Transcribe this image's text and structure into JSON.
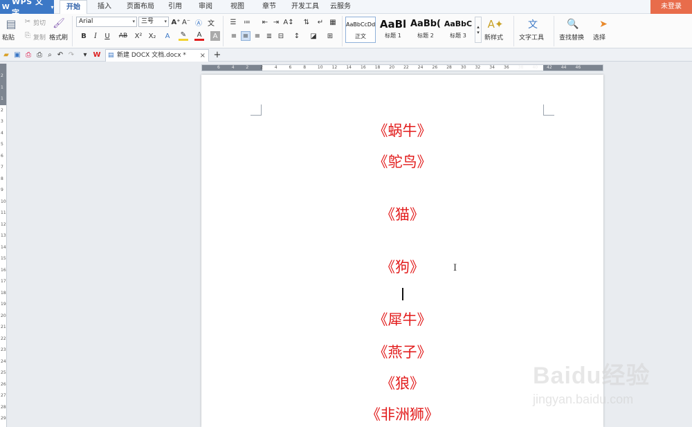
{
  "app": {
    "name": "WPS 文字",
    "login": "未登录"
  },
  "menu_tabs": [
    "开始",
    "插入",
    "页面布局",
    "引用",
    "审阅",
    "视图",
    "章节",
    "开发工具",
    "云服务"
  ],
  "active_tab": "开始",
  "ribbon": {
    "paste": "粘贴",
    "cut": "剪切",
    "copy": "复制",
    "format_painter": "格式刷",
    "font_name": "Arial",
    "font_size": "三号",
    "styles": [
      {
        "preview": "AaBbCcDd",
        "name": "正文"
      },
      {
        "preview": "AaBl",
        "name": "标题 1"
      },
      {
        "preview": "AaBb(",
        "name": "标题 2"
      },
      {
        "preview": "AaBbC",
        "name": "标题 3"
      }
    ],
    "new_style": "新样式",
    "text_tools": "文字工具",
    "find_replace": "查找替换",
    "select": "选择"
  },
  "document_tab": {
    "title": "新建 DOCX 文档.docx *"
  },
  "horizontal_ruler": [
    "6",
    "4",
    "2",
    "2",
    "4",
    "6",
    "8",
    "10",
    "12",
    "14",
    "16",
    "18",
    "20",
    "22",
    "24",
    "26",
    "28",
    "30",
    "32",
    "34",
    "36",
    "38",
    "40",
    "42",
    "44",
    "46"
  ],
  "vertical_ruler": [
    "2",
    "1",
    "1",
    "2",
    "3",
    "4",
    "5",
    "6",
    "7",
    "8",
    "9",
    "10",
    "11",
    "12",
    "13",
    "14",
    "15",
    "16",
    "17",
    "18",
    "19",
    "20",
    "21",
    "22",
    "23",
    "24",
    "25",
    "26",
    "27",
    "28",
    "29"
  ],
  "document_lines": [
    "《蜗牛》",
    "《鸵鸟》",
    "《猫》",
    "《狗》",
    "《犀牛》",
    "《燕子》",
    "《狼》",
    "《非洲狮》"
  ],
  "watermark": {
    "brand": "Baidu经验",
    "url": "jingyan.baidu.com"
  },
  "colors": {
    "accent": "#3c78c6",
    "text_red": "#e21b1b",
    "login_bg": "#e86c4b"
  }
}
